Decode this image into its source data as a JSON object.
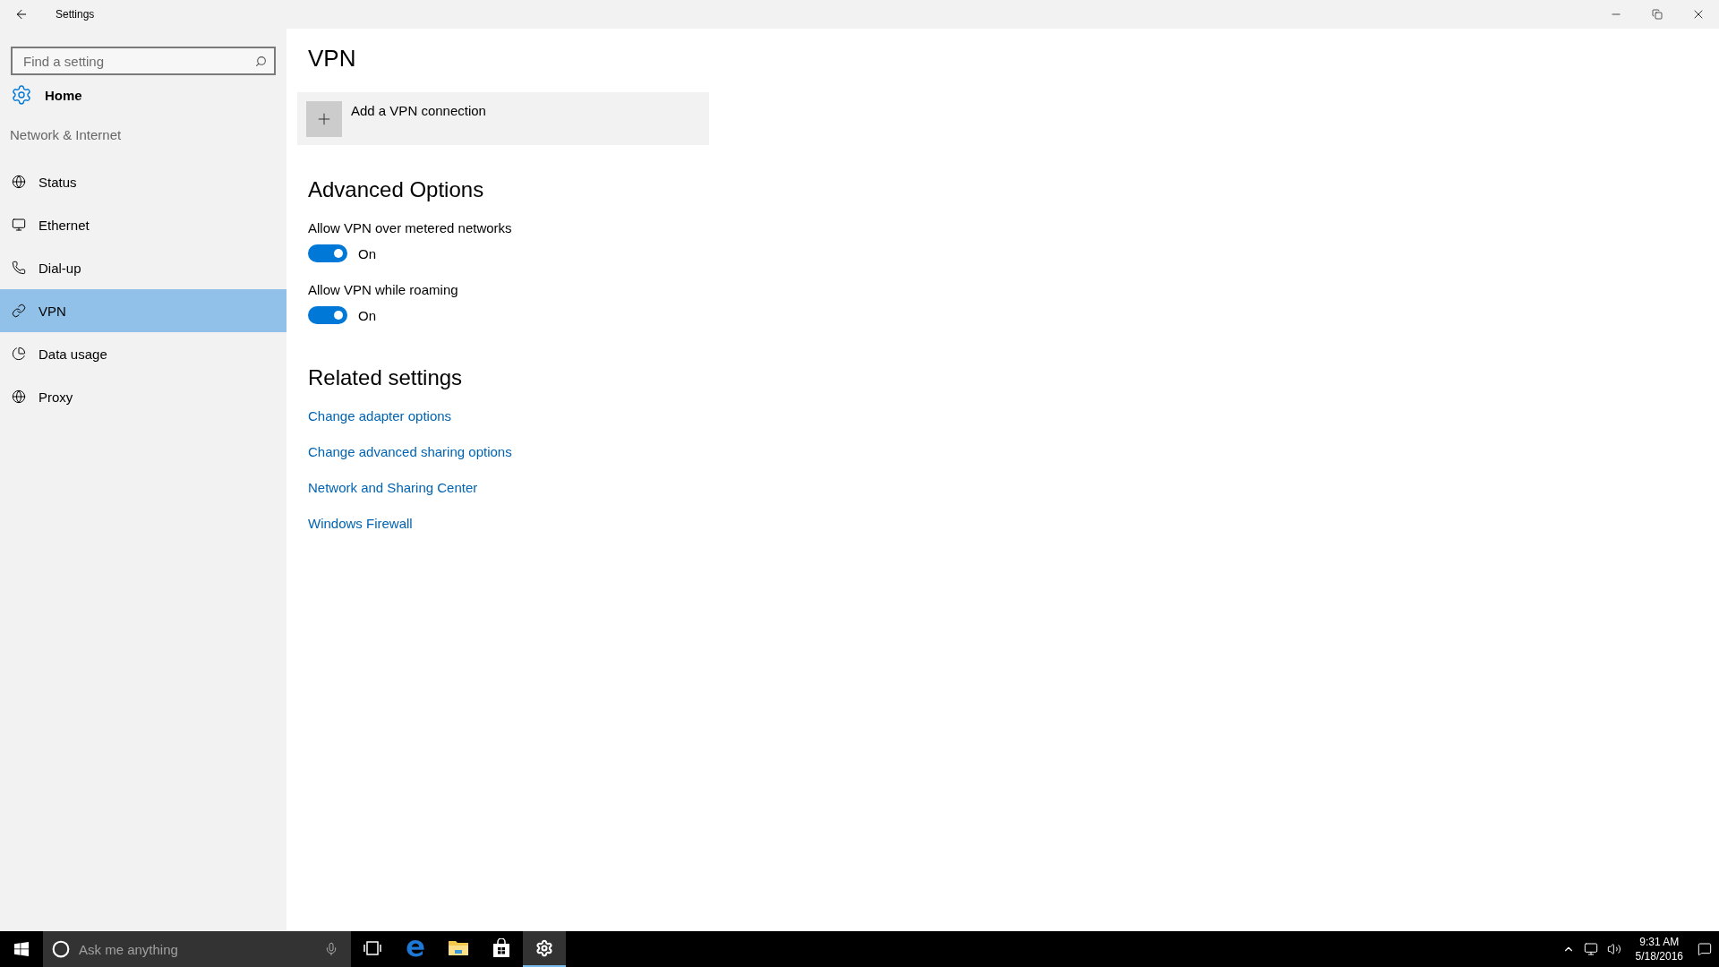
{
  "window": {
    "title": "Settings"
  },
  "sidebar": {
    "search": {
      "placeholder": "Find a setting"
    },
    "home": "Home",
    "section": "Network & Internet",
    "items": [
      {
        "kind": "status",
        "label": "Status",
        "selected": false
      },
      {
        "kind": "ethernet",
        "label": "Ethernet",
        "selected": false
      },
      {
        "kind": "dialup",
        "label": "Dial-up",
        "selected": false
      },
      {
        "kind": "vpn",
        "label": "VPN",
        "selected": true
      },
      {
        "kind": "data",
        "label": "Data usage",
        "selected": false
      },
      {
        "kind": "proxy",
        "label": "Proxy",
        "selected": false
      }
    ]
  },
  "content": {
    "title": "VPN",
    "add_button": "Add a VPN connection",
    "advanced_heading": "Advanced Options",
    "toggles": [
      {
        "label": "Allow VPN over metered networks",
        "on": true,
        "state_text": "On"
      },
      {
        "label": "Allow VPN while roaming",
        "on": true,
        "state_text": "On"
      }
    ],
    "related_heading": "Related settings",
    "links": [
      "Change adapter options",
      "Change advanced sharing options",
      "Network and Sharing Center",
      "Windows Firewall"
    ]
  },
  "taskbar": {
    "search_placeholder": "Ask me anything",
    "apps": [
      {
        "kind": "taskview",
        "selected": false
      },
      {
        "kind": "edge",
        "selected": false
      },
      {
        "kind": "explorer",
        "selected": false
      },
      {
        "kind": "store",
        "selected": false
      },
      {
        "kind": "settings",
        "selected": true
      }
    ],
    "time": "9:31 AM",
    "date": "5/18/2016"
  }
}
